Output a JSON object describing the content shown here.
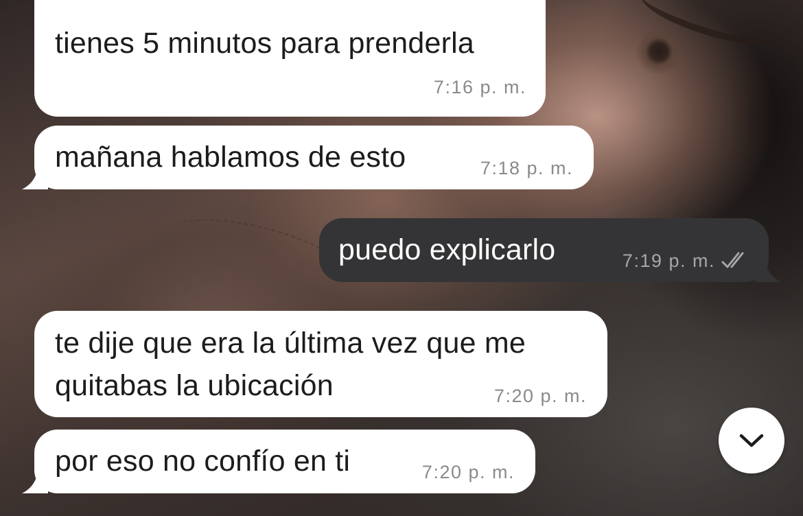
{
  "messages": [
    {
      "direction": "incoming",
      "text": "tienes 5 minutos para prenderla",
      "time": "7:16 p. m."
    },
    {
      "direction": "incoming",
      "text": "mañana hablamos de esto",
      "time": "7:18 p. m."
    },
    {
      "direction": "outgoing",
      "text": "puedo explicarlo",
      "time": "7:19 p. m.",
      "status_icon": "double-check-icon"
    },
    {
      "direction": "incoming",
      "text": "te dije que era la última vez que me\nquitabas la ubicación",
      "time": "7:20 p. m."
    },
    {
      "direction": "incoming",
      "text": "por eso no confío en ti",
      "time": "7:20 p. m."
    }
  ],
  "scroll_button": {
    "icon": "chevron-down-icon"
  },
  "colors": {
    "incoming_bubble": "#ffffff",
    "outgoing_bubble": "#343436",
    "incoming_text": "#1c1c1e",
    "outgoing_text": "#ffffff",
    "timestamp": "#8a8a8e",
    "reply_accent": "#f0325a"
  }
}
